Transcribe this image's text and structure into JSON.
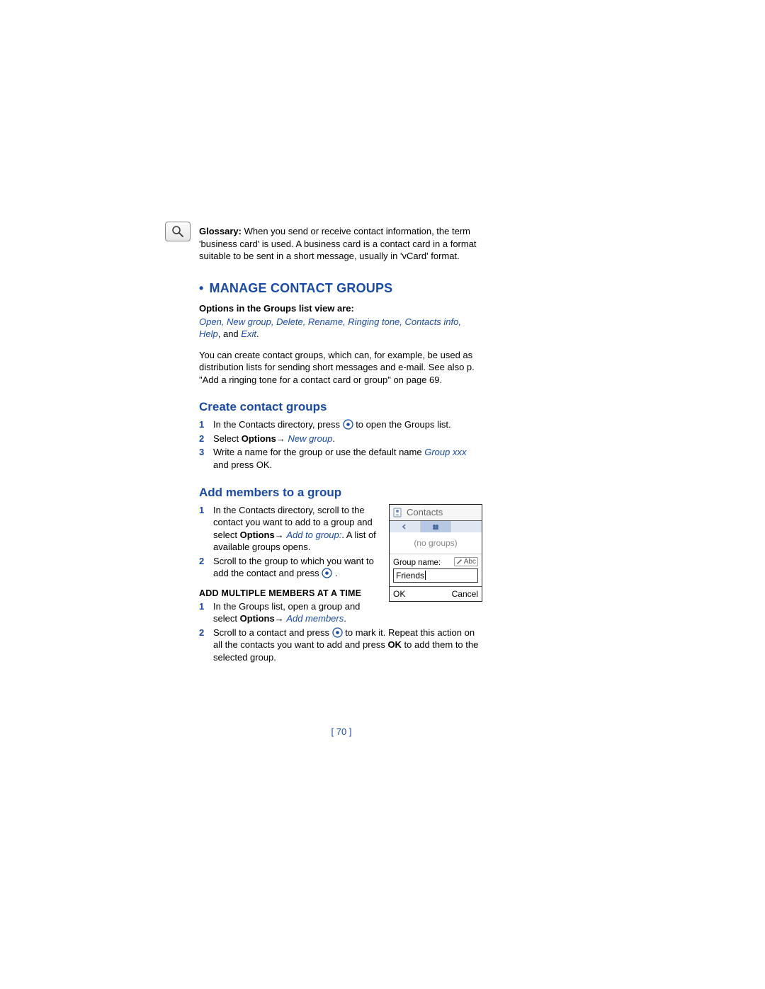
{
  "glossary": {
    "label": "Glossary:",
    "text": "When you send or receive contact information, the term 'business card' is used. A business card is a contact card in a format suitable to be sent in a short message, usually in 'vCard' format."
  },
  "heading_main": "MANAGE CONTACT GROUPS",
  "options_line": {
    "label": "Options in the Groups list view are:",
    "items_blue": "Open, New group, Delete, Rename, Ringing tone, Contacts info, Help",
    "tail": ", and ",
    "last_blue": "Exit",
    "period": "."
  },
  "intro_para": "You can create contact groups, which can, for example, be used as distribution lists for sending short messages and e-mail. See also p. \"Add a ringing tone for a contact card or group\" on page 69.",
  "create": {
    "heading": "Create contact groups",
    "steps": [
      {
        "pre": "In the Contacts directory, press ",
        "post": " to open the Groups list."
      },
      {
        "pre": "Select ",
        "bold": "Options",
        "arrow": "→ ",
        "blue": "New group",
        "post": "."
      },
      {
        "pre": "Write a name for the group or use the default name ",
        "blue": "Group xxx",
        "post": " and press OK."
      }
    ]
  },
  "add": {
    "heading": "Add members to a group",
    "steps": [
      {
        "pre": "In the Contacts directory, scroll to the contact you want to add to a group and select ",
        "bold": "Options",
        "arrow": "→ ",
        "blue": "Add to group:",
        "post": ". A list of available groups opens."
      },
      {
        "pre": "Scroll to the group to which you want to add the contact and press ",
        "post": "."
      }
    ],
    "sub_heading": "ADD MULTIPLE MEMBERS AT A TIME",
    "sub_steps": [
      {
        "pre": "In the Groups list, open a group and select ",
        "bold": "Options",
        "arrow": "→ ",
        "blue": "Add members",
        "post": "."
      },
      {
        "pre": "Scroll to a contact and press ",
        "mid": " to mark it. Repeat this action on all the contacts you want to add and press ",
        "bold2": "OK",
        "post": " to add them to the selected group."
      }
    ]
  },
  "phone": {
    "app": "Contacts",
    "empty": "(no groups)",
    "field_label": "Group name:",
    "abc": "Abc",
    "value": "Friends",
    "ok": "OK",
    "cancel": "Cancel"
  },
  "page_number": "[ 70 ]"
}
